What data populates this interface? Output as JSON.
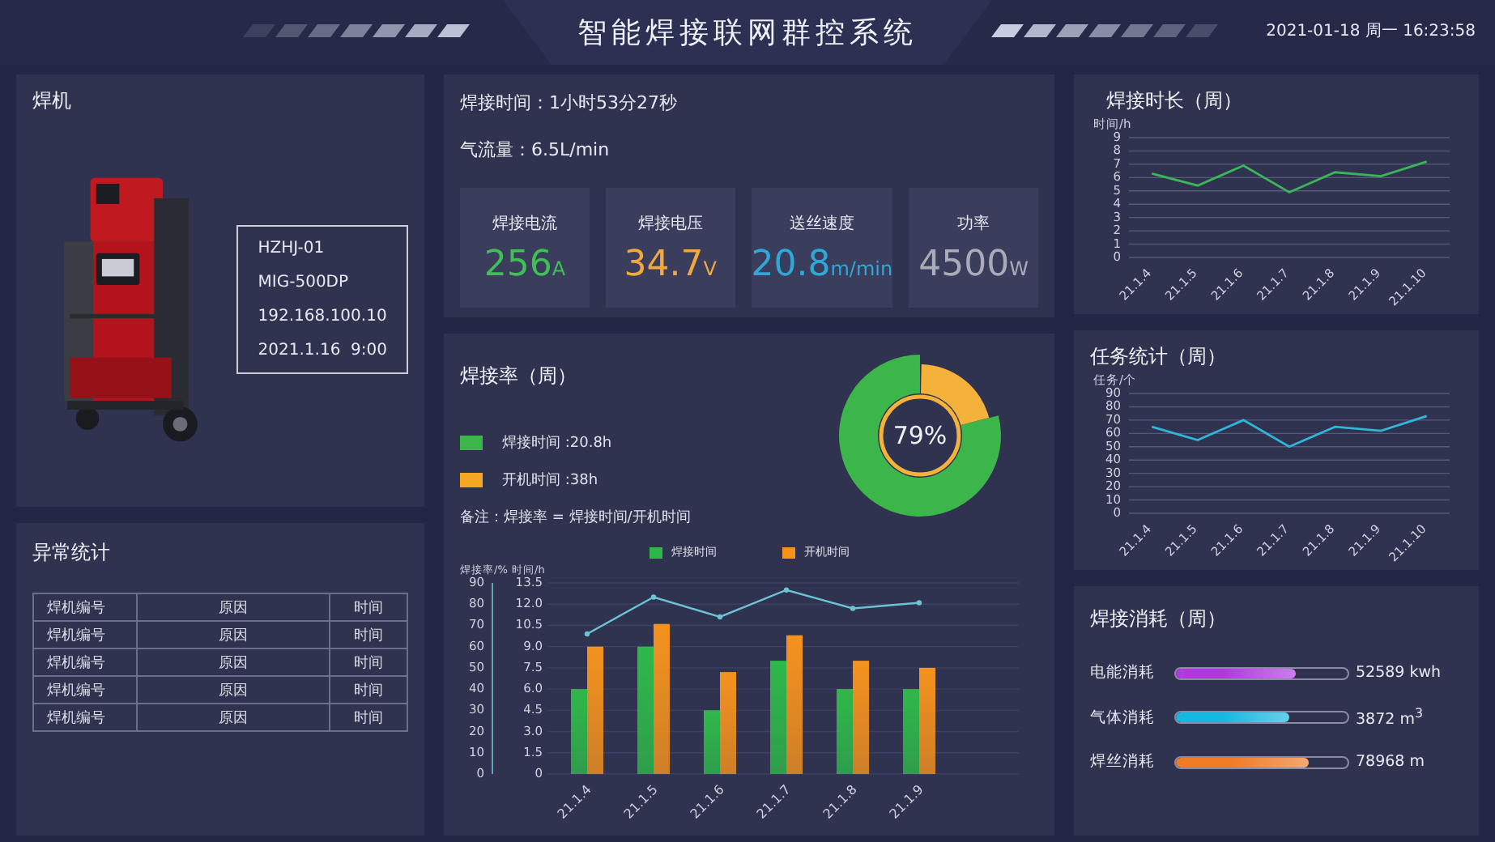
{
  "header": {
    "title": "智能焊接联网群控系统",
    "datetime": "2021-01-18 周一 16:23:58"
  },
  "machine": {
    "title": "焊机",
    "picture": {
      "kind": "picture"
    },
    "info": [
      "HZHJ-01",
      "MIG-500DP",
      "192.168.100.10",
      "2021.1.16  9:00"
    ]
  },
  "anomalies": {
    "title": "异常统计",
    "table": {
      "rows": [
        [
          "焊机编号",
          "原因",
          "时间"
        ],
        [
          "焊机编号",
          "原因",
          "时间"
        ],
        [
          "焊机编号",
          "原因",
          "时间"
        ],
        [
          "焊机编号",
          "原因",
          "时间"
        ],
        [
          "焊机编号",
          "原因",
          "时间"
        ]
      ]
    }
  },
  "status": {
    "lines": [
      "焊接时间：1小时53分27秒",
      "气流量：6.5L/min"
    ],
    "metrics": [
      {
        "label": "焊接电流",
        "value": "256",
        "unit": "A",
        "color": "#3fbf55"
      },
      {
        "label": "焊接电压",
        "value": "34.7",
        "unit": "V",
        "color": "#f0a93a"
      },
      {
        "label": "送丝速度",
        "value": "20.8",
        "unit": "m/min",
        "color": "#2fa8d8"
      },
      {
        "label": "功率",
        "value": "4500",
        "unit": "W",
        "color": "#a9abb8"
      }
    ]
  },
  "weld_rate": {
    "title": "焊接率（周）",
    "legend": [
      {
        "label": "焊接时间 :20.8h",
        "color": "#3cb54a"
      },
      {
        "label": "开机时间 :38h",
        "color": "#f5a623"
      }
    ],
    "note": "备注：焊接率 = 焊接时间/开机时间",
    "donut": {
      "label": "79%",
      "chart_data": {
        "type": "donut",
        "series": [
          {
            "values": [
              79,
              21
            ]
          }
        ],
        "colors": [
          "#3cb54a",
          "#f5b23a"
        ]
      }
    },
    "rate_axis": {
      "label": "焊接率/%",
      "ticks": [
        "90",
        "80",
        "70",
        "60",
        "50",
        "40",
        "30",
        "20",
        "10",
        "0"
      ]
    },
    "chart_data": {
      "type": "bar",
      "categories": [
        "21.1.4",
        "21.1.5",
        "21.1.6",
        "21.1.7",
        "21.1.8",
        "21.1.9"
      ],
      "ylabel": "时间/h",
      "ylim": [
        0,
        13.5
      ],
      "grid": true,
      "yticks": [
        {
          "value": 0,
          "label": "0"
        },
        {
          "value": 1.5,
          "label": "1.5"
        },
        {
          "value": 3,
          "label": "3.0"
        },
        {
          "value": 4.5,
          "label": "4.5"
        },
        {
          "value": 6,
          "label": "6.0"
        },
        {
          "value": 7.5,
          "label": "7.5"
        },
        {
          "value": 9,
          "label": "9.0"
        },
        {
          "value": 10.5,
          "label": "10.5"
        },
        {
          "value": 12,
          "label": "12.0"
        },
        {
          "value": 13.5,
          "label": "13.5"
        }
      ],
      "series": [
        {
          "name": "焊接时间",
          "color": "#2fb84a",
          "values": [
            6,
            9,
            4.5,
            8,
            6,
            6
          ]
        },
        {
          "name": "开机时间",
          "color": "#f5921e",
          "values": [
            9,
            10.6,
            7.2,
            9.8,
            8,
            7.5
          ]
        },
        {
          "type": "line",
          "marker": true,
          "color": "#6cc3d5",
          "values": [
            9.9,
            12.5,
            11.1,
            13,
            11.7,
            12.1
          ]
        }
      ]
    }
  },
  "weld_hours": {
    "title": "焊接时长（周）",
    "chart_data": {
      "type": "line",
      "categories": [
        "21.1.4",
        "21.1.5",
        "21.1.6",
        "21.1.7",
        "21.1.8",
        "21.1.9",
        "21.1.10"
      ],
      "ylabel": "时间/h",
      "ylim": [
        0,
        9
      ],
      "grid": true,
      "yticks": [
        0,
        1,
        2,
        3,
        4,
        5,
        6,
        7,
        8,
        9
      ],
      "series": [
        {
          "color": "#3cb55a",
          "values": [
            6.3,
            5.4,
            6.9,
            4.9,
            6.4,
            6.1,
            7.2
          ]
        }
      ]
    }
  },
  "tasks": {
    "title": "任务统计（周）",
    "chart_data": {
      "type": "line",
      "categories": [
        "21.1.4",
        "21.1.5",
        "21.1.6",
        "21.1.7",
        "21.1.8",
        "21.1.9",
        "21.1.10"
      ],
      "ylabel": "任务/个",
      "ylim": [
        0,
        90
      ],
      "grid": true,
      "yticks": [
        0,
        10,
        20,
        30,
        40,
        50,
        60,
        70,
        80,
        90
      ],
      "series": [
        {
          "color": "#2fb6d8",
          "values": [
            65,
            55,
            70,
            50,
            65,
            62,
            73
          ]
        }
      ]
    }
  },
  "consumption": {
    "title": "焊接消耗（周）",
    "items": [
      {
        "label": "电能消耗",
        "level": 0.7,
        "value": "52589 kwh",
        "color": "#b03ae0"
      },
      {
        "label": "气体消耗",
        "level": 0.66,
        "value": "3872 m$^{3}$",
        "color": "#15b8e0"
      },
      {
        "label": "焊丝消耗",
        "level": 0.77,
        "value": "78968 m",
        "color": "#f07a25"
      }
    ]
  }
}
